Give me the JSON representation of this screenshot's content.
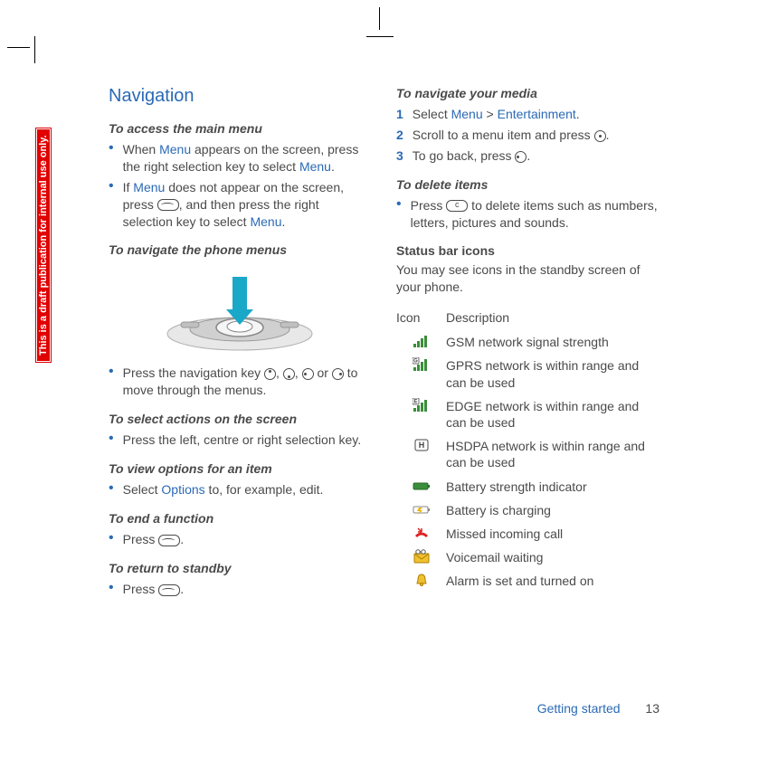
{
  "banner": "This is a draft publication for internal use only.",
  "heading": "Navigation",
  "left": {
    "s1": {
      "title": "To access the main menu",
      "b1a": "When ",
      "b1b": "Menu",
      "b1c": " appears on the screen, press the right selection key to select ",
      "b1d": "Menu",
      "b1e": ".",
      "b2a": "If ",
      "b2b": "Menu",
      "b2c": " does not appear on the screen, press ",
      "b2d": ", and then press the right selection key to select ",
      "b2e": "Menu",
      "b2f": "."
    },
    "s2": {
      "title": "To navigate the phone menus"
    },
    "s3": {
      "b1a": "Press the navigation key ",
      "b1b": ", ",
      "b1c": ", ",
      "b1d": " or ",
      "b1e": " to move through the menus."
    },
    "s4": {
      "title": "To select actions on the screen",
      "b1": "Press the left, centre or right selection key."
    },
    "s5": {
      "title": "To view options for an item",
      "b1a": "Select ",
      "b1b": "Options",
      "b1c": " to, for example, edit."
    },
    "s6": {
      "title": "To end a function",
      "b1a": "Press ",
      "b1b": "."
    },
    "s7": {
      "title": "To return to standby",
      "b1a": "Press ",
      "b1b": "."
    }
  },
  "right": {
    "s1": {
      "title": "To navigate your media",
      "n1a": "Select ",
      "n1b": "Menu",
      "n1c": " > ",
      "n1d": "Entertainment",
      "n1e": ".",
      "n2a": "Scroll to a menu item and press ",
      "n2b": ".",
      "n3a": "To go back, press ",
      "n3b": "."
    },
    "s2": {
      "title": "To delete items",
      "b1a": "Press ",
      "b1b": " to delete items such as numbers, letters, pictures and sounds."
    },
    "s3": {
      "title": "Status bar icons",
      "p1": "You may see icons in the standby screen of your phone."
    },
    "table": {
      "h1": "Icon",
      "h2": "Description",
      "r1": "GSM network signal strength",
      "r2": "GPRS network is within range and can be used",
      "r3": "EDGE network is within range and can be used",
      "r4": "HSDPA network is within range and can be used",
      "r5": "Battery strength indicator",
      "r6": "Battery is charging",
      "r7": "Missed incoming call",
      "r8": "Voicemail waiting",
      "r9": "Alarm is set and turned on"
    }
  },
  "nums": {
    "n1": "1",
    "n2": "2",
    "n3": "3"
  },
  "footer": {
    "chapter": "Getting started",
    "page": "13"
  }
}
